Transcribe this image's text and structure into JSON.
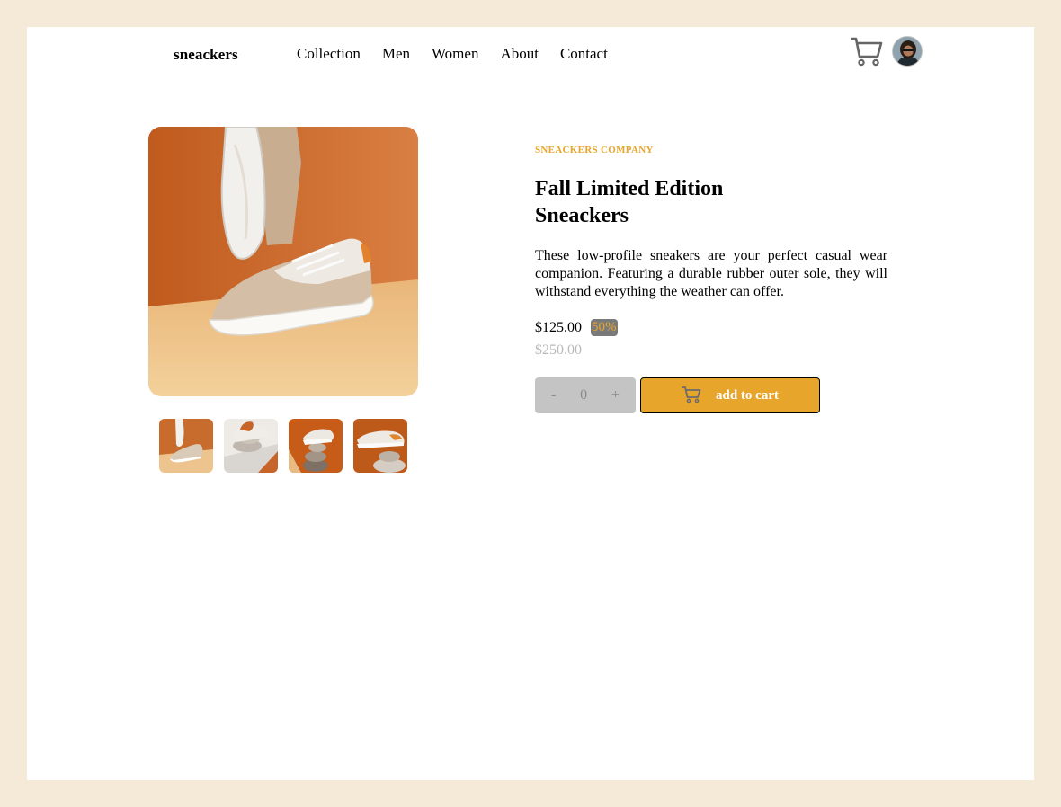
{
  "header": {
    "brand": "sneackers",
    "nav": [
      "Collection",
      "Men",
      "Women",
      "About",
      "Contact"
    ],
    "icons": {
      "cart": "cart-icon",
      "avatar": "user-avatar"
    }
  },
  "gallery": {
    "thumbnails": [
      "thumbnail-1",
      "thumbnail-2",
      "thumbnail-3",
      "thumbnail-4"
    ]
  },
  "product": {
    "company": "SNEACKERS COMPANY",
    "title": "Fall Limited Edition Sneackers",
    "description": "These low-profile sneakers are your perfect casual wear companion. Featuring a durable rubber outer sole, they will withstand everything the weather can offer.",
    "price": "$125.00",
    "discount": "50%",
    "old_price": "$250.00"
  },
  "quantity": {
    "minus": "-",
    "value": "0",
    "plus": "+"
  },
  "cart_button": {
    "label": "add to cart"
  },
  "colors": {
    "accent": "#e8a52b",
    "page_bg": "#f5e9d8",
    "card_bg": "#ffffff",
    "muted": "#b8b8b8",
    "qty_bg": "#c4c4c4"
  }
}
